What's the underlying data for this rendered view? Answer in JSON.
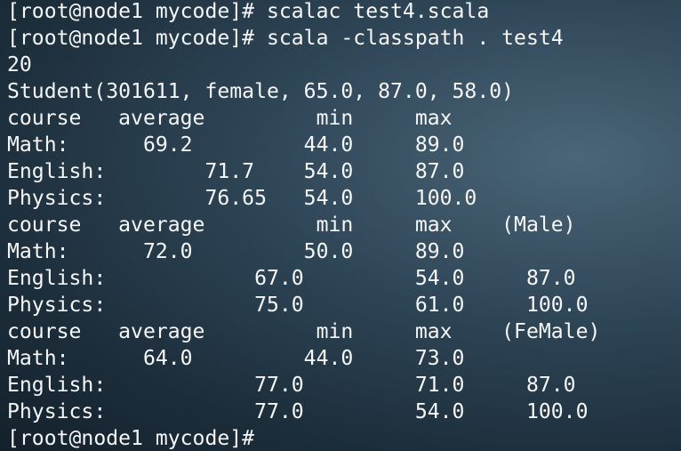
{
  "terminal": {
    "lines": [
      "[root@node1 mycode]# scalac test4.scala",
      "[root@node1 mycode]# scala -classpath . test4",
      "20",
      "Student(301611, female, 65.0, 87.0, 58.0)",
      "course   average         min     max",
      "Math:      69.2         44.0     89.0",
      "English:        71.7    54.0     87.0",
      "Physics:        76.65   54.0     100.0",
      "course   average         min     max    (Male)",
      "Math:      72.0         50.0     89.0",
      "English:            67.0         54.0     87.0",
      "Physics:            75.0         61.0     100.0",
      "course   average         min     max    (FeMale)",
      "Math:      64.0         44.0     73.0",
      "English:            77.0         71.0     87.0",
      "Physics:            77.0         54.0     100.0",
      "[root@node1 mycode]#"
    ]
  }
}
